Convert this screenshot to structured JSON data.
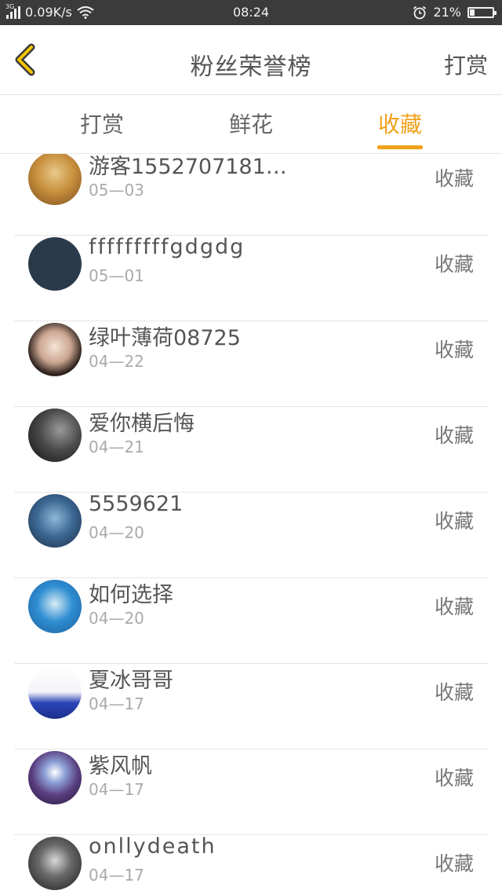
{
  "status_bar": {
    "network_badge": "3G",
    "speed": "0.09K/s",
    "time": "08:24",
    "battery": "21%",
    "battery_level": 0.21
  },
  "header": {
    "title": "粉丝荣誉榜",
    "action": "打赏",
    "accent_color": "#f0a11b"
  },
  "tabs": [
    {
      "label": "打赏",
      "active": false
    },
    {
      "label": "鲜花",
      "active": false
    },
    {
      "label": "收藏",
      "active": true
    }
  ],
  "fans": [
    {
      "name": "游客1552707181…",
      "date": "05—03",
      "action": "收藏"
    },
    {
      "name": "fffffffffgdgdg",
      "date": "05—01",
      "action": "收藏"
    },
    {
      "name": "绿叶薄荷08725",
      "date": "04—22",
      "action": "收藏"
    },
    {
      "name": "爱你横后悔",
      "date": "04—21",
      "action": "收藏"
    },
    {
      "name": "5559621",
      "date": "04—20",
      "action": "收藏"
    },
    {
      "name": "如何选择",
      "date": "04—20",
      "action": "收藏"
    },
    {
      "name": "夏冰哥哥",
      "date": "04—17",
      "action": "收藏"
    },
    {
      "name": "紫风帆",
      "date": "04—17",
      "action": "收藏"
    },
    {
      "name": "onllydeath",
      "date": "04—17",
      "action": "收藏"
    }
  ]
}
